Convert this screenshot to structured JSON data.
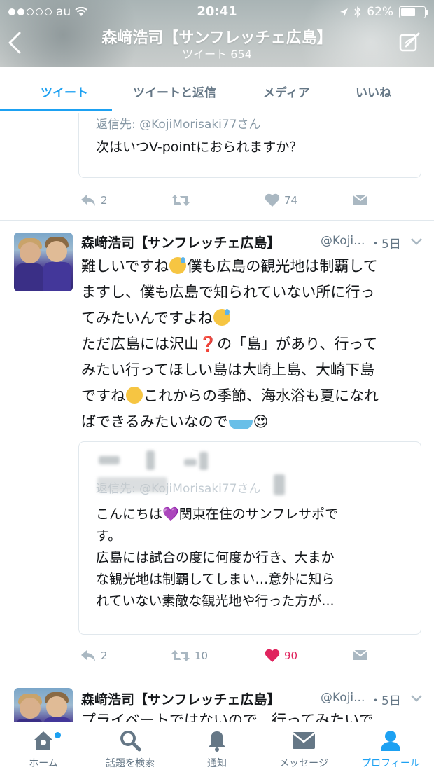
{
  "status_bar": {
    "carrier": "au",
    "time": "20:41",
    "battery": "62%",
    "battery_level": 0.62
  },
  "header": {
    "title": "森﨑浩司【サンフレッチェ広島】",
    "subtitle": "ツイート 654"
  },
  "tabs": [
    {
      "label": "ツイート",
      "active": true
    },
    {
      "label": "ツイートと返信",
      "active": false
    },
    {
      "label": "メディア",
      "active": false
    },
    {
      "label": "いいね",
      "active": false
    }
  ],
  "top_tweet": {
    "quote": {
      "reply_to": "返信先: @KojiMorisaki77さん",
      "text": "次はいつV-pointにおられますか？"
    },
    "replies": "2",
    "retweets": "",
    "likes": "74"
  },
  "tweet1": {
    "name": "森﨑浩司【サンフレッチェ広島】",
    "handle": "@Koji...",
    "time": "・5日",
    "body": {
      "l1a": "難しいですね",
      "l1b": "僕も広島の観光地は制覇して",
      "l2": "ますし、僕も広島で知られていない所に行っ",
      "l3": "てみたいんですよね",
      "l4a": "ただ広島には沢山",
      "l4b": "の「島」があり、行って",
      "l5": "みたい行ってほしい島は大崎上島、大崎下島",
      "l6a": "ですね",
      "l6b": "これからの季節、海水浴も夏になれ",
      "l7": "ばできるみたいなので",
      "question_mark": "❓",
      "heart_eyes": "😍"
    },
    "quote": {
      "reply_to": "返信先: @KojiMorisaki77さん",
      "l1a": "こんにちは",
      "l1b": "関東在住のサンフレサポで",
      "l2": "す。",
      "l3": "広島には試合の度に何度か行き、大まか",
      "l4": "な観光地は制覇してしまい…意外に知ら",
      "l5": "れていない素敵な観光地や行った方が...",
      "purple_heart": "💜"
    },
    "replies": "2",
    "retweets": "10",
    "likes": "90"
  },
  "tweet2": {
    "name": "森﨑浩司【サンフレッチェ広島】",
    "handle": "@Koji...",
    "time": "・5日",
    "body_partial": "プライベートではないので、行ってみたいで"
  },
  "bottom_nav": [
    {
      "label": "ホーム",
      "icon": "home-icon",
      "active": false
    },
    {
      "label": "話題を検索",
      "icon": "search-icon",
      "active": false
    },
    {
      "label": "通知",
      "icon": "bell-icon",
      "active": false
    },
    {
      "label": "メッセージ",
      "icon": "mail-icon",
      "active": false
    },
    {
      "label": "プロフィール",
      "icon": "profile-icon",
      "active": true
    }
  ],
  "colors": {
    "accent": "#1da1f2",
    "like": "#e0245e",
    "muted": "#657786"
  }
}
